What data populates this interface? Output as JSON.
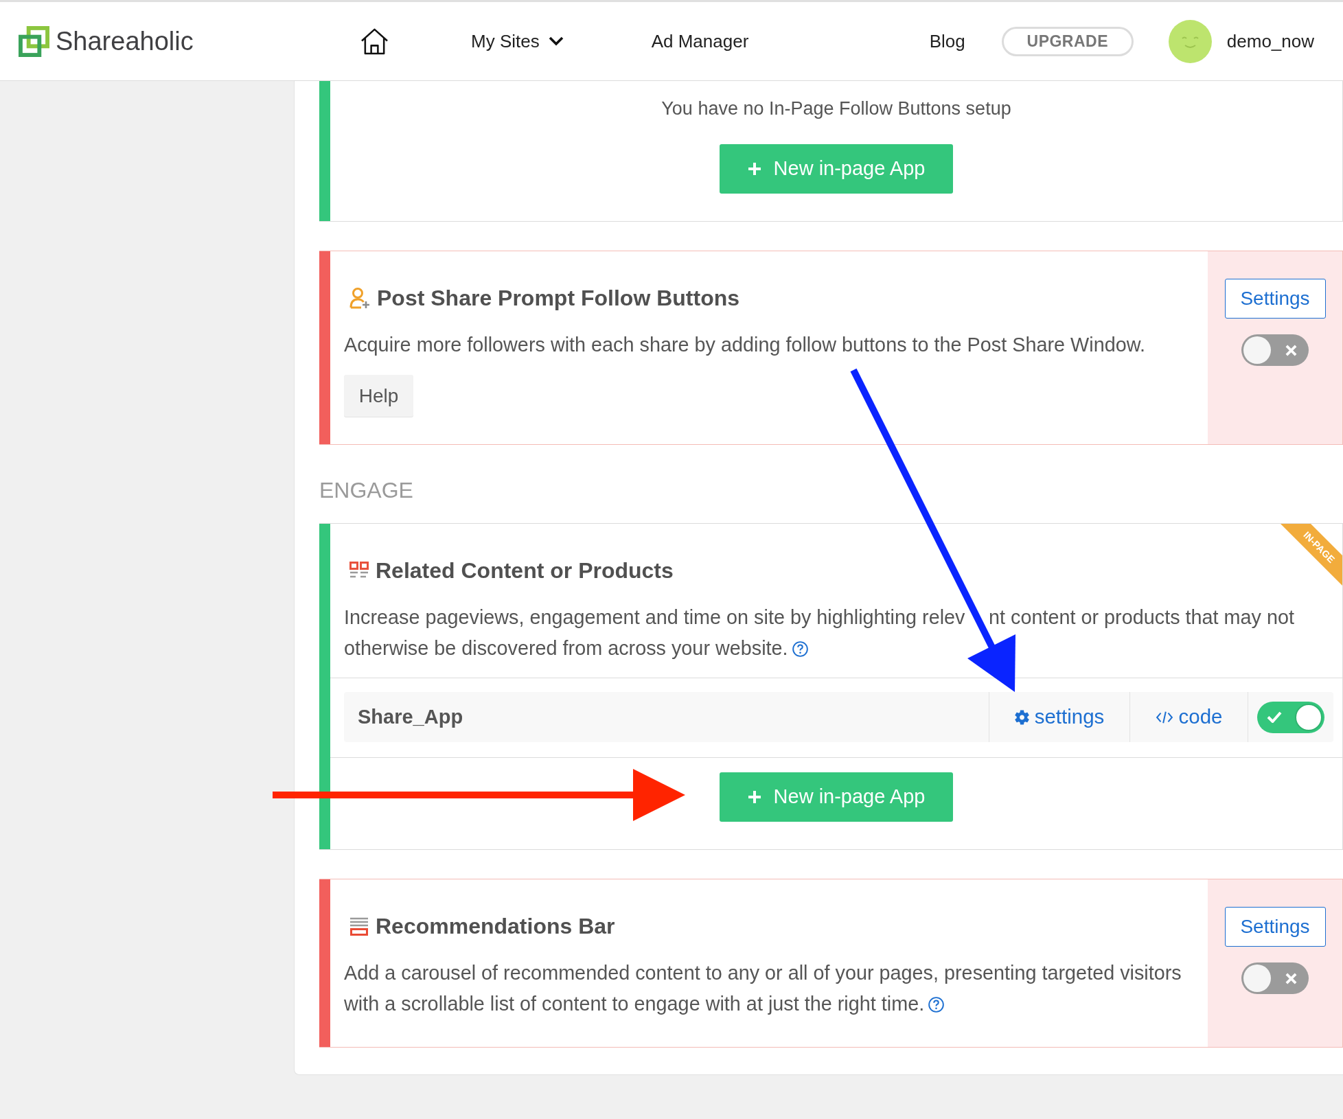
{
  "header": {
    "logo": "Shareaholic",
    "nav": [
      {
        "kind": "home"
      },
      {
        "kind": "dropdown",
        "label": "My Sites"
      },
      {
        "kind": "link",
        "label": "Ad Manager"
      }
    ],
    "account": [
      {
        "kind": "link",
        "label": "Blog"
      },
      {
        "kind": "pill",
        "label": "UPGRADE"
      }
    ],
    "user": "demo_now"
  },
  "sections": [
    {
      "kind": "card",
      "enabled": true,
      "empty_message": "You have no In-Page Follow Buttons setup",
      "new_button": "New in-page App"
    },
    {
      "kind": "card",
      "enabled": false,
      "title": "Post Share Prompt Follow Buttons",
      "description": "Acquire more followers with each share by adding follow buttons to the Post Share Window.",
      "help_button": "Help",
      "side": {
        "settings_button": "Settings",
        "on": false
      }
    },
    {
      "kind": "heading",
      "label": "ENGAGE"
    },
    {
      "kind": "card",
      "enabled": true,
      "ribbon": "IN-PAGE",
      "title": "Related Content or Products",
      "description": "Increase pageviews, engagement and time on site by highlighting relev  nt content or products that may not otherwise be discovered from across your website.",
      "help_icon": true,
      "apps": [
        {
          "name": "Share_App",
          "settings": "settings",
          "code": "code",
          "on": true
        }
      ],
      "new_button": "New in-page App"
    },
    {
      "kind": "card",
      "enabled": false,
      "title": "Recommendations Bar",
      "description": "Add a carousel of recommended content to any or all of your pages, presenting targeted visitors with a scrollable list of content to engage with at just the right time.",
      "help_icon": true,
      "side": {
        "settings_button": "Settings",
        "on": false
      }
    }
  ],
  "annotation_arrows": [
    {
      "color": "#0a24ff"
    },
    {
      "color": "#ff2400"
    }
  ]
}
